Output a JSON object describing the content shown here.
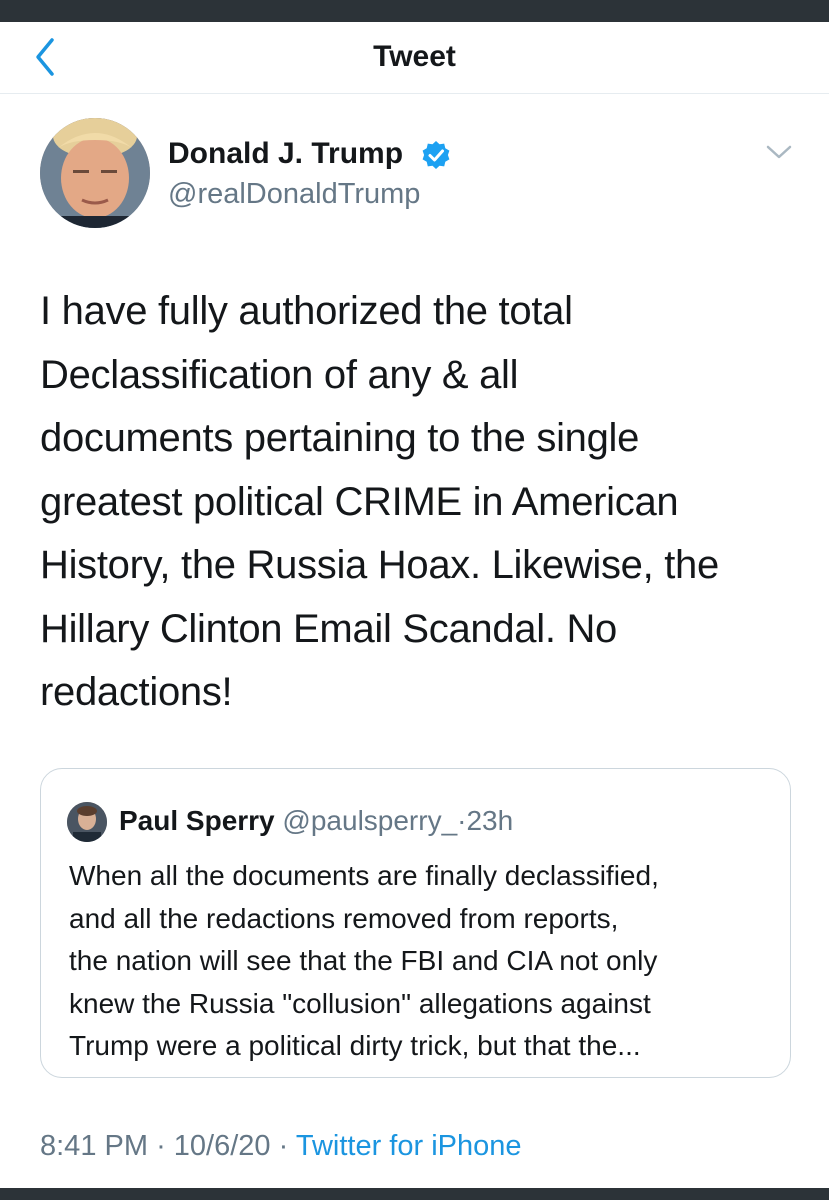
{
  "header": {
    "title": "Tweet"
  },
  "tweet": {
    "author_name": "Donald J. Trump",
    "author_handle": "@realDonaldTrump",
    "text_lines": [
      "I have fully authorized the total",
      "Declassification of any & all",
      "documents pertaining to the single",
      "greatest political CRIME in American",
      "History, the Russia Hoax. Likewise, the",
      "Hillary Clinton Email Scandal. No",
      "redactions!"
    ],
    "time": "8:41 PM",
    "date": "10/6/20",
    "separator": "·",
    "source": "Twitter for iPhone"
  },
  "quote": {
    "author_name": "Paul Sperry",
    "author_handle": "@paulsperry_",
    "separator": "·",
    "time_ago": "23h",
    "text_lines": [
      "When all the documents are finally declassified,",
      "and all the redactions removed from reports,",
      "the nation will see that the FBI and CIA not only",
      "knew the Russia \"collusion\" allegations against",
      "Trump were a political dirty trick, but that the..."
    ]
  },
  "icons": {
    "back": "chevron-left-icon",
    "verified": "verified-badge-icon",
    "more": "chevron-down-icon"
  },
  "colors": {
    "accent": "#1b95e0",
    "text_primary": "#14171a",
    "text_secondary": "#657786",
    "border": "#ccd6dd",
    "verified": "#1da1f2"
  }
}
